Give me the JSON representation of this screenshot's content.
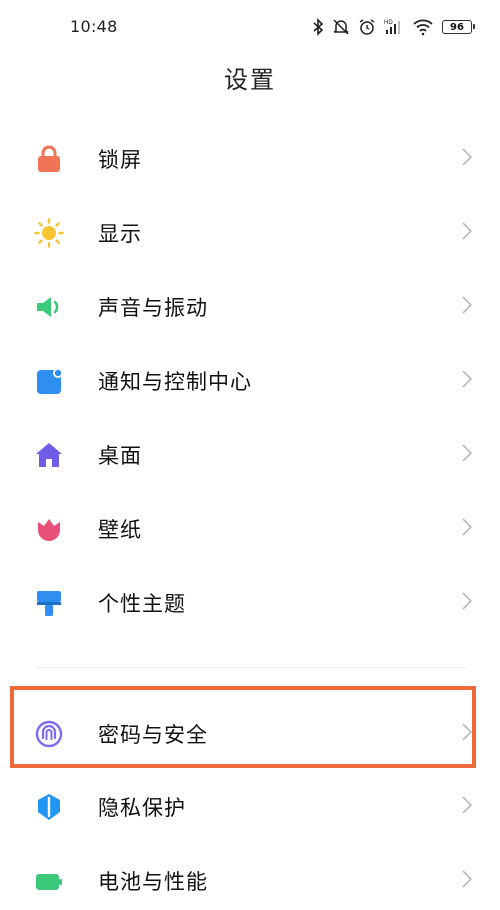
{
  "status_bar": {
    "time": "10:48",
    "battery": "96",
    "icons": [
      "bluetooth-icon",
      "mute-icon",
      "alarm-icon",
      "hd-signal-icon",
      "wifi-icon",
      "battery-icon"
    ]
  },
  "page": {
    "title": "设置"
  },
  "settings": {
    "items": [
      {
        "label": "锁屏",
        "icon": "lock-icon",
        "color": "#f07455"
      },
      {
        "label": "显示",
        "icon": "sun-icon",
        "color": "#f7c533"
      },
      {
        "label": "声音与振动",
        "icon": "speaker-icon",
        "color": "#3cc97a"
      },
      {
        "label": "通知与控制中心",
        "icon": "notification-icon",
        "color": "#2e8ff0"
      },
      {
        "label": "桌面",
        "icon": "home-icon",
        "color": "#6f5de8"
      },
      {
        "label": "壁纸",
        "icon": "tulip-icon",
        "color": "#e8507a"
      },
      {
        "label": "个性主题",
        "icon": "brush-icon",
        "color": "#2e8ff0"
      },
      {
        "label": "密码与安全",
        "icon": "fingerprint-icon",
        "color": "#7b6cf0"
      },
      {
        "label": "隐私保护",
        "icon": "shield-icon",
        "color": "#2196f3"
      },
      {
        "label": "电池与性能",
        "icon": "battery-icon",
        "color": "#3cc97a"
      }
    ]
  },
  "highlight_color": "#ee6a3a"
}
